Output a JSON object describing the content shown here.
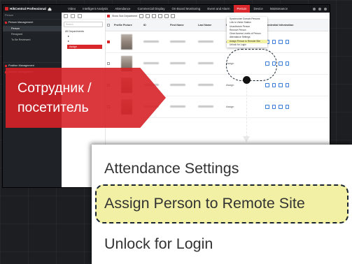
{
  "app": {
    "name": "HikCentral Professional",
    "nav": [
      "Video",
      "Intelligent Analysis",
      "Attendance",
      "Commercial Display",
      "On-Board Monitoring",
      "Event and Alarm",
      "Person",
      "Device",
      "Maintenance"
    ],
    "active_nav": "Person"
  },
  "sidebar": {
    "header": "Person",
    "groups": [
      {
        "label": "Person Management",
        "items": [
          "Person",
          "Resigned",
          "To Be Reviewed"
        ]
      },
      {
        "label": "Position Management",
        "items": []
      },
      {
        "label": "Access Management",
        "items": []
      }
    ]
  },
  "tree": {
    "search_placeholder": "Search",
    "root": "All Departments",
    "assign_label": "Assign"
  },
  "toolbar": {
    "show_sub_department": "Show Sub Department"
  },
  "table": {
    "headers": [
      "Profile Picture",
      "ID",
      "First Name",
      "Last Name",
      "Department",
      "Credential Information"
    ],
    "rows": [
      {
        "dept": "Assign"
      },
      {
        "dept": "Assign"
      },
      {
        "dept": "Assign"
      },
      {
        "dept": "Assign"
      }
    ]
  },
  "menu": {
    "items": [
      "Synchronize Domain Persons",
      "Link to Visitor Station",
      "Unauthorize Person",
      "Remove Person",
      "Clear Access Levels of Person",
      "Attendance Settings",
      "Assign Person to Remote Site",
      "Unlock for Login"
    ],
    "highlighted": "Assign Person to Remote Site"
  },
  "banner": {
    "line1": "Сотрудник /",
    "line2": "посетитель"
  },
  "zoom": {
    "items": [
      "Attendance Settings",
      "Assign Person to Remote Site",
      "Unlock for Login"
    ]
  },
  "colors": {
    "accent": "#d8282b",
    "highlight": "#f2f0a4",
    "dark": "#1f2226"
  }
}
